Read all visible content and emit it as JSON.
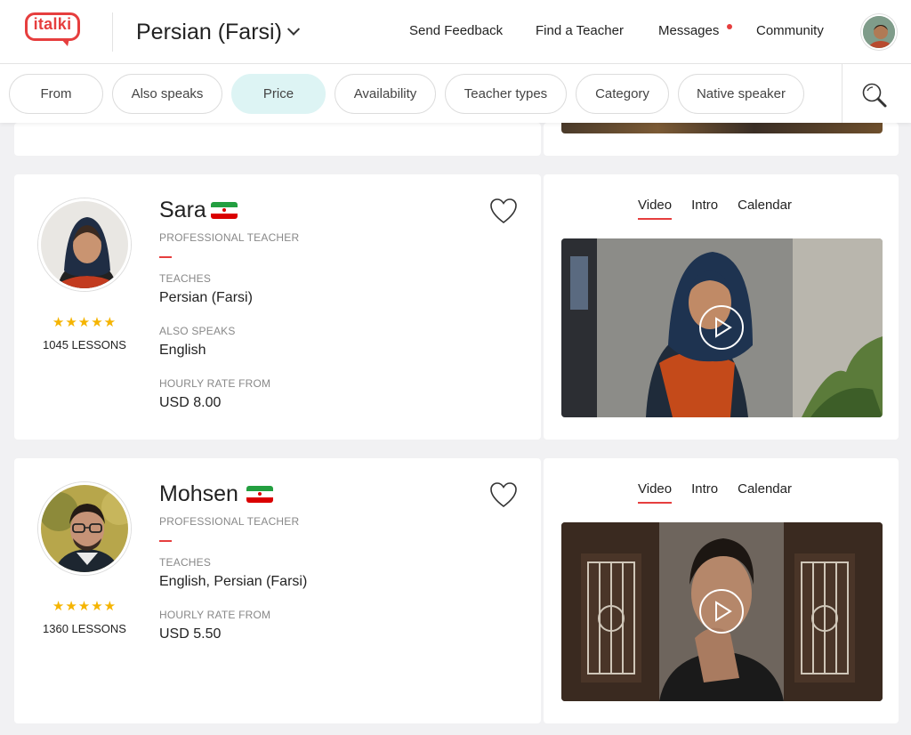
{
  "header": {
    "logo_text": "italki",
    "language": "Persian (Farsi)",
    "nav": [
      "Send Feedback",
      "Find a Teacher",
      "Messages",
      "Community"
    ]
  },
  "filters": {
    "pills": [
      "From",
      "Also speaks",
      "Price",
      "Availability",
      "Teacher types",
      "Category",
      "Native speaker"
    ],
    "active": "Price"
  },
  "teachers": [
    {
      "name": "Sara",
      "role": "PROFESSIONAL TEACHER",
      "stars": "★★★★★",
      "lessons": "1045 LESSONS",
      "teaches_label": "TEACHES",
      "teaches": "Persian (Farsi)",
      "also_label": "ALSO SPEAKS",
      "also": "English",
      "rate_label": "HOURLY RATE FROM",
      "rate": "USD 8.00",
      "tabs": [
        "Video",
        "Intro",
        "Calendar"
      ]
    },
    {
      "name": "Mohsen",
      "role": "PROFESSIONAL TEACHER",
      "stars": "★★★★★",
      "lessons": "1360 LESSONS",
      "teaches_label": "TEACHES",
      "teaches": "English, Persian (Farsi)",
      "rate_label": "HOURLY RATE FROM",
      "rate": "USD 5.50",
      "tabs": [
        "Video",
        "Intro",
        "Calendar"
      ]
    }
  ],
  "colors": {
    "brand_red": "#e63e3e",
    "active_pill": "#ddf4f4",
    "star": "#f5b400"
  },
  "icons": [
    "logo-icon",
    "chevron-down-icon",
    "notification-dot-icon",
    "search-icon",
    "heart-icon",
    "play-icon",
    "iran-flag-icon"
  ]
}
